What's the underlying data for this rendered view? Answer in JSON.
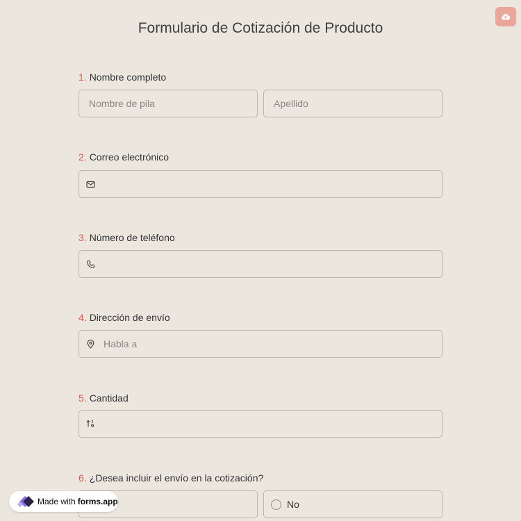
{
  "form": {
    "title": "Formulario de Cotización de Producto"
  },
  "questions": [
    {
      "number": "1.",
      "label": "Nombre completo",
      "first_placeholder": "Nombre de pila",
      "last_placeholder": "Apellido"
    },
    {
      "number": "2.",
      "label": "Correo electrónico",
      "icon": "mail-icon"
    },
    {
      "number": "3.",
      "label": "Número de teléfono",
      "icon": "phone-icon"
    },
    {
      "number": "4.",
      "label": "Dirección de envío",
      "icon": "map-pin-icon",
      "placeholder": "Habla a"
    },
    {
      "number": "5.",
      "label": "Cantidad",
      "icon": "sort-numeric-icon"
    },
    {
      "number": "6.",
      "label": "¿Desea incluir el envío en la cotización?",
      "options": [
        "",
        "No"
      ]
    }
  ],
  "badge": {
    "made_with": "Made with",
    "brand": "forms.app"
  },
  "colors": {
    "background": "#ebe7de",
    "accent": "#e05a4e",
    "save_button": "#eba69c"
  }
}
